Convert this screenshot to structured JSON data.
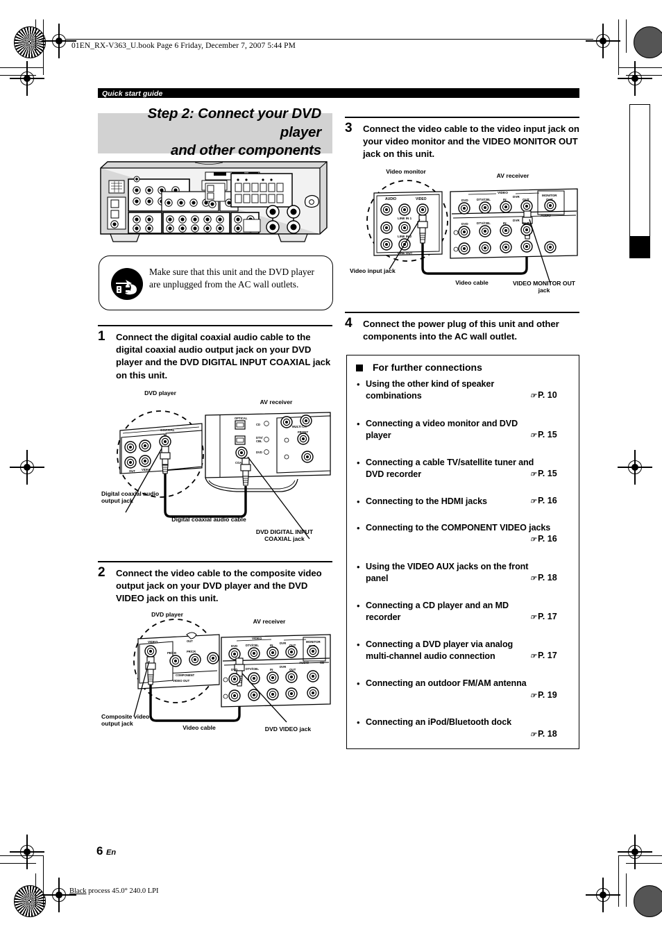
{
  "print_marks": {
    "file_header": "01EN_RX-V363_U.book  Page 6  Friday, December 7, 2007  5:44 PM",
    "process_note_prefix": "Black",
    "process_note": " process 45.0° 240.0 LPI"
  },
  "running_head": "Quick start guide",
  "section_title_line1": "Step 2: Connect your DVD player",
  "section_title_line2": "and other components",
  "warning": {
    "icon": "unplug-power-icon",
    "text": "Make sure that this unit and the DVD player are unplugged from the AC wall outlets."
  },
  "steps": [
    {
      "number": "1",
      "text": "Connect the digital coaxial audio cable to the digital coaxial audio output jack on your DVD player and the DVD DIGITAL INPUT COAXIAL jack on this unit.",
      "figure": {
        "device_left": "DVD player",
        "device_right": "AV receiver",
        "callout_left": "Digital coaxial audio output jack",
        "callout_center": "Digital coaxial audio cable",
        "callout_right": "DVD DIGITAL INPUT COAXIAL jack",
        "jack_labels_left": [
          "COAXIAL",
          "OUT",
          "VIDEO"
        ],
        "jack_labels_right": [
          "OPTICAL",
          "CD",
          "DTV/CBL",
          "DVD",
          "COAX",
          "MULTI CH",
          "FRONT"
        ]
      }
    },
    {
      "number": "2",
      "text": "Connect the video cable to the composite video output jack on your DVD player and the DVD VIDEO jack on this unit.",
      "figure": {
        "device_left": "DVD player",
        "device_right": "AV receiver",
        "callout_left": "Composite video output jack",
        "callout_center": "Video cable",
        "callout_right": "DVD VIDEO jack",
        "jack_labels_left": [
          "VIDEO",
          "PB/CB",
          "PR/CR",
          "COMPONENT",
          "VIDEO OUT",
          "OUT"
        ],
        "jack_labels_right": [
          "VIDEO",
          "DVD",
          "DTV/CBL",
          "IN",
          "DVR",
          "OUT",
          "MONITOR OUT",
          "AUDIO",
          "CD"
        ]
      }
    },
    {
      "number": "3",
      "text": "Connect the video cable to the video input jack on your video monitor and the VIDEO MONITOR OUT jack on this unit.",
      "figure": {
        "device_left": "Video monitor",
        "device_right": "AV receiver",
        "callout_left": "Video input jack",
        "callout_center": "Video cable",
        "callout_right": "VIDEO MONITOR OUT jack",
        "jack_labels_left": [
          "AUDIO",
          "VIDEO",
          "LINE IN 1",
          "LINE IN 2",
          "LINE OUT"
        ],
        "jack_labels_right": [
          "VIDEO",
          "DVD",
          "DTV/CBL",
          "IN",
          "DVR",
          "OUT",
          "MONITOR OUT",
          "AUDIO"
        ]
      }
    },
    {
      "number": "4",
      "text": "Connect the power plug of this unit and other components into the AC wall outlet.",
      "figure": null
    }
  ],
  "further_connections": {
    "heading": "For further connections",
    "bullet": "•",
    "hand_icon": "pointing-hand-icon",
    "items": [
      {
        "label": "Using the other kind of speaker combinations",
        "page": "P. 10"
      },
      {
        "label": "Connecting a video monitor and DVD player",
        "page": "P. 15"
      },
      {
        "label": "Connecting a cable TV/satellite tuner and DVD recorder",
        "page": "P. 15"
      },
      {
        "label": "Connecting to the HDMI jacks",
        "page": "P. 16"
      },
      {
        "label": "Connecting to the COMPONENT VIDEO jacks",
        "page": "P. 16"
      },
      {
        "label": "Using the VIDEO AUX jacks on the front panel",
        "page": "P. 18"
      },
      {
        "label": "Connecting a CD player and an MD recorder",
        "page": "P. 17"
      },
      {
        "label": "Connecting a DVD player via analog multi-channel audio connection",
        "page": "P. 17"
      },
      {
        "label": "Connecting an outdoor FM/AM antenna",
        "page": "P. 19"
      },
      {
        "label": "Connecting an iPod/Bluetooth dock",
        "page": "P. 18"
      }
    ]
  },
  "footer": {
    "page_number": "6",
    "language": "En"
  }
}
